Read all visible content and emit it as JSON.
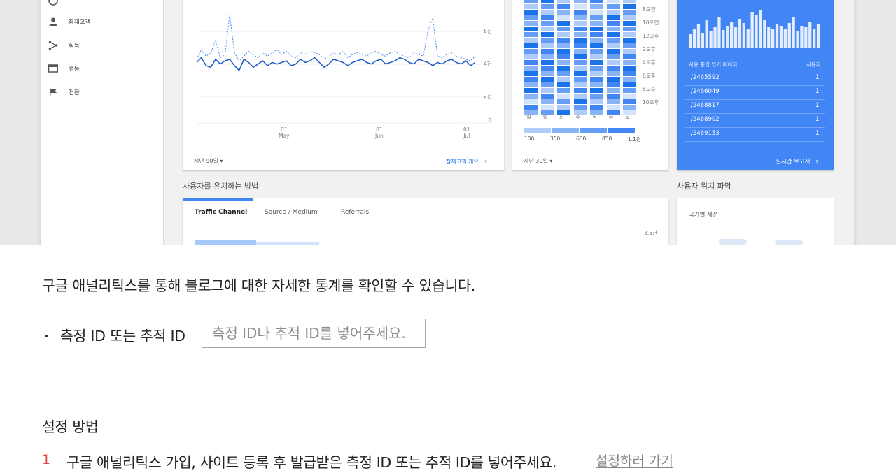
{
  "preview": {
    "sidebar": [
      {
        "label": "잠재고객",
        "icon": "person-icon"
      },
      {
        "label": "획득",
        "icon": "acquisition-icon"
      },
      {
        "label": "행동",
        "icon": "behavior-icon"
      },
      {
        "label": "전환",
        "icon": "flag-icon"
      }
    ],
    "line_card": {
      "y_ticks": [
        "6천",
        "4천",
        "2천",
        "0"
      ],
      "x_ticks": [
        {
          "day": "01",
          "month": "May"
        },
        {
          "day": "01",
          "month": "Jun"
        },
        {
          "day": "01",
          "month": "Jul"
        }
      ],
      "period_label": "지난 90일",
      "overview_link": "잠재고객 개요",
      "series": {
        "solid": [
          38,
          41,
          36,
          35,
          40,
          37,
          39,
          40,
          36,
          33,
          40,
          38,
          35,
          37,
          39,
          36,
          38,
          37,
          38,
          39,
          36,
          37,
          40,
          38,
          39,
          41,
          38,
          35,
          37,
          40,
          39,
          38,
          36,
          38,
          39,
          40,
          38,
          37,
          39,
          40,
          37,
          38,
          39,
          41,
          40,
          38,
          37,
          40,
          39,
          38,
          36,
          38,
          37,
          39,
          40,
          38,
          37,
          39,
          36,
          38
        ],
        "dashed": [
          40,
          46,
          42,
          44,
          52,
          41,
          43,
          48,
          44,
          39,
          42,
          45,
          43,
          41,
          44,
          42,
          44,
          46,
          43,
          45,
          42,
          41,
          44,
          43,
          45,
          44,
          43,
          40,
          42,
          44,
          43,
          45,
          41,
          43,
          44,
          43,
          42,
          44,
          45,
          43,
          42,
          44,
          45,
          43,
          42,
          41,
          44,
          43,
          42,
          58,
          40,
          42,
          41,
          43,
          44,
          42,
          41,
          40,
          39,
          42
        ]
      },
      "spikes": [
        {
          "index": 7,
          "value": 68
        },
        {
          "index": 50,
          "value": 66
        }
      ]
    },
    "heatmap_card": {
      "time_labels": [
        "8오전",
        "10오전",
        "12오후",
        "2오후",
        "4오후",
        "6오후",
        "8오후",
        "10오후"
      ],
      "day_labels": [
        "일",
        "월",
        "화",
        "수",
        "목",
        "금",
        "토"
      ],
      "legend_values": [
        "100",
        "350",
        "600",
        "850",
        "1.1천"
      ],
      "period_label": "지난 30일"
    },
    "realtime_card": {
      "pages_header": "사용 중인 인기 페이지",
      "users_header": "사용자",
      "rows": [
        {
          "page": "/2465592",
          "users": "1"
        },
        {
          "page": "/2466049",
          "users": "1"
        },
        {
          "page": "/2468817",
          "users": "1"
        },
        {
          "page": "/2468902",
          "users": "1"
        },
        {
          "page": "/2469153",
          "users": "1"
        }
      ],
      "report_link": "실시간 보고서",
      "bars": [
        20,
        28,
        35,
        22,
        40,
        24,
        30,
        45,
        26,
        32,
        38,
        30,
        42,
        36,
        28,
        52,
        48,
        55,
        40,
        30,
        27,
        35,
        32,
        28,
        36,
        44,
        24,
        32,
        30,
        38,
        28,
        34
      ]
    },
    "acquisition": {
      "title": "사용자를 유치하는 방법",
      "tabs": [
        "Traffic Channel",
        "Source / Medium",
        "Referrals"
      ],
      "y_tick": "3.5천"
    },
    "location": {
      "title": "사용자 위치 파악",
      "subtitle": "국가별 세션"
    }
  },
  "content": {
    "intro": "구글 애널리틱스를 통해 블로그에 대한 자세한 통계를 확인할 수 있습니다.",
    "bullet": "•",
    "id_label": "측정 ID 또는 추적 ID",
    "id_placeholder": "측정 ID나 추적 ID를 넣어주세요.",
    "id_value": "",
    "setup_title": "설정 방법",
    "step_number": "1",
    "step_text": "구글 애널리틱스 가입, 사이트 등록 후 발급받은 측정 ID 또는 추적 ID를 넣어주세요.",
    "step_link": "설정하러 가기"
  },
  "colors": {
    "accent_blue": "#4285f4",
    "step_red": "#e2453c",
    "link_blue": "#1a73e8"
  }
}
